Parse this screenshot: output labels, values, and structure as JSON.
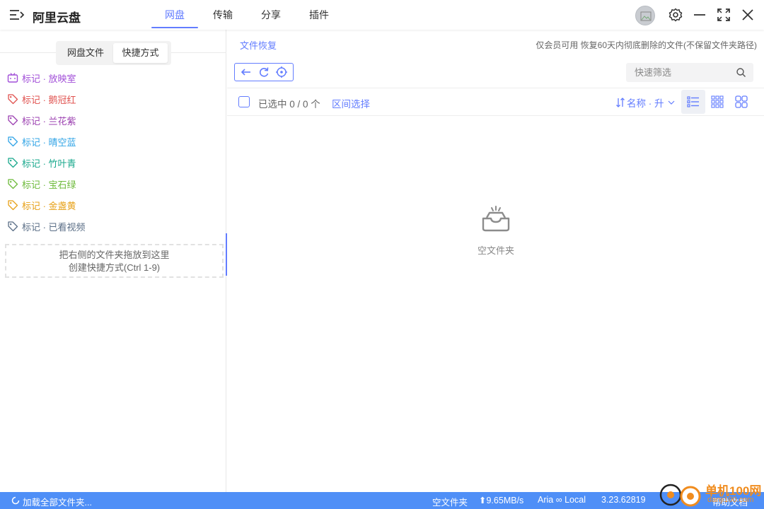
{
  "app": {
    "title": "阿里云盘",
    "nav_tabs": [
      {
        "label": "网盘",
        "active": true
      },
      {
        "label": "传输",
        "active": false
      },
      {
        "label": "分享",
        "active": false
      },
      {
        "label": "插件",
        "active": false
      }
    ],
    "window_controls": [
      "avatar",
      "settings-icon",
      "minimize-icon",
      "fullscreen-icon",
      "close-icon"
    ]
  },
  "sidebar": {
    "segments": [
      {
        "label": "网盘文件",
        "active": false
      },
      {
        "label": "快捷方式",
        "active": true
      }
    ],
    "shortcuts": [
      {
        "label": "标记 · 放映室",
        "color": "#a14ed8",
        "icon": "tv-icon"
      },
      {
        "label": "标记 · 鹅冠红",
        "color": "#e0524f",
        "icon": "tag-icon"
      },
      {
        "label": "标记 · 兰花紫",
        "color": "#9b3fb0",
        "icon": "tag-icon"
      },
      {
        "label": "标记 · 晴空蓝",
        "color": "#2fa3e6",
        "icon": "tag-icon"
      },
      {
        "label": "标记 · 竹叶青",
        "color": "#18a88c",
        "icon": "tag-icon"
      },
      {
        "label": "标记 · 宝石绿",
        "color": "#6dba3a",
        "icon": "tag-icon"
      },
      {
        "label": "标记 · 金盏黄",
        "color": "#e7a118",
        "icon": "tag-icon"
      },
      {
        "label": "标记 · 已看视频",
        "color": "#5a6e86",
        "icon": "tag-icon"
      }
    ],
    "dropzone_line1": "把右侧的文件夹拖放到这里",
    "dropzone_line2": "创建快捷方式(Ctrl 1-9)"
  },
  "main": {
    "breadcrumb": "文件恢复",
    "notice": "仅会员可用 恢复60天内彻底删除的文件(不保留文件夹路径)",
    "filter_placeholder": "快速筛选",
    "selection_text": "已选中 0 / 0 个",
    "range_select": "区间选择",
    "sort_label": "名称 · 升",
    "empty_text": "空文件夹"
  },
  "statusbar": {
    "loading": "加载全部文件夹...",
    "folder_state": "空文件夹",
    "speed": "9.65MB/s",
    "engine": "Aria ∞ Local",
    "version": "3.23.62819",
    "help": "帮助文档"
  },
  "watermark": {
    "text1": "单机100网",
    "text2": "danji100.com"
  },
  "colors": {
    "accent": "#637dff",
    "statusbar": "#4f8ff7"
  }
}
